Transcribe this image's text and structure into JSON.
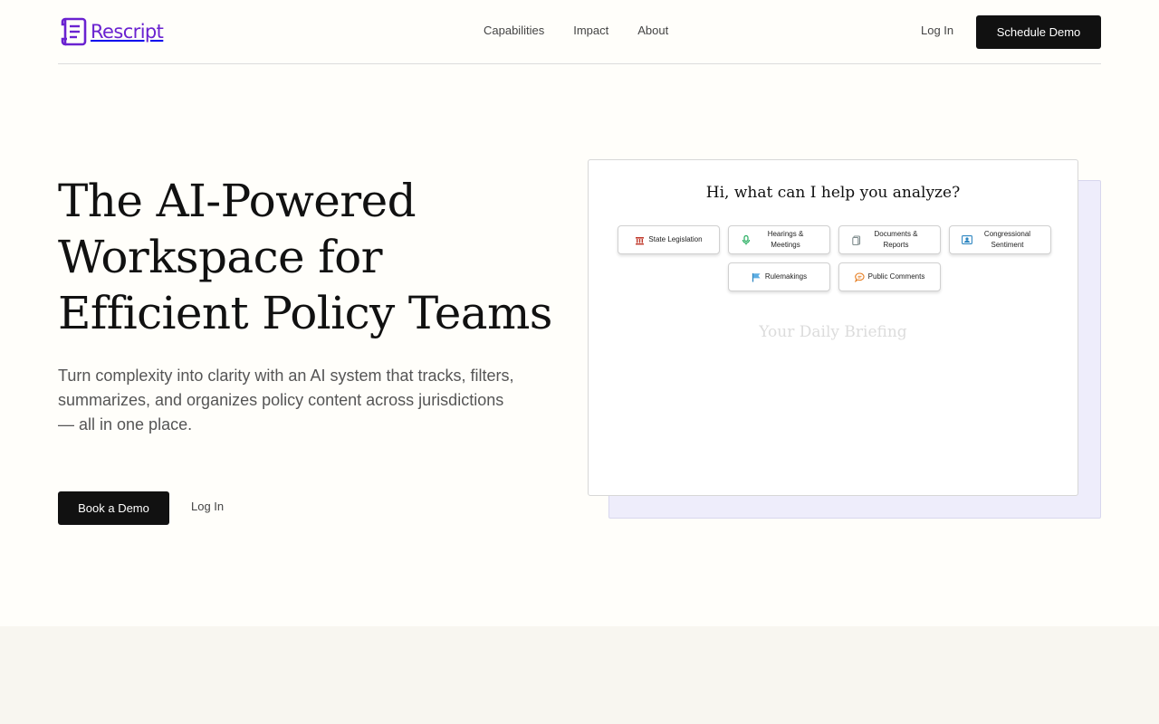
{
  "header": {
    "logo_text": "Rescript",
    "logo_icon": "scroll-icon",
    "nav": [
      "Capabilities",
      "Impact",
      "About"
    ],
    "login_label": "Log In",
    "cta_label": "Schedule Demo"
  },
  "hero": {
    "title": "The AI-Powered Workspace for Efficient Policy Teams",
    "subtitle_line1": "Turn complexity into clarity with an AI system that tracks, filters, summarizes, and organizes policy content across jurisdictions",
    "subtitle_line2": "— all in one place.",
    "primary_cta": "Book a Demo",
    "secondary_cta": "Log In"
  },
  "preview": {
    "prompt": "Hi, what can I help you analyze?",
    "chips": [
      {
        "label": "State Legislation",
        "icon": "capitol-icon",
        "color": "#c0392b"
      },
      {
        "label": "Hearings & Meetings",
        "icon": "microphone-icon",
        "color": "#27ae60"
      },
      {
        "label": "Documents & Reports",
        "icon": "document-icon",
        "color": "#7f8c8d"
      },
      {
        "label": "Congressional Sentiment",
        "icon": "person-card-icon",
        "color": "#2e86c1"
      },
      {
        "label": "Rulemakings",
        "icon": "flag-icon",
        "color": "#2e86c1"
      },
      {
        "label": "Public Comments",
        "icon": "speech-bubble-icon",
        "color": "#e67e22"
      }
    ],
    "briefing_label": "Your Daily Briefing"
  },
  "colors": {
    "brand": "#6a22d0",
    "cta_bg": "#111111",
    "page_bg": "#fffefa"
  }
}
